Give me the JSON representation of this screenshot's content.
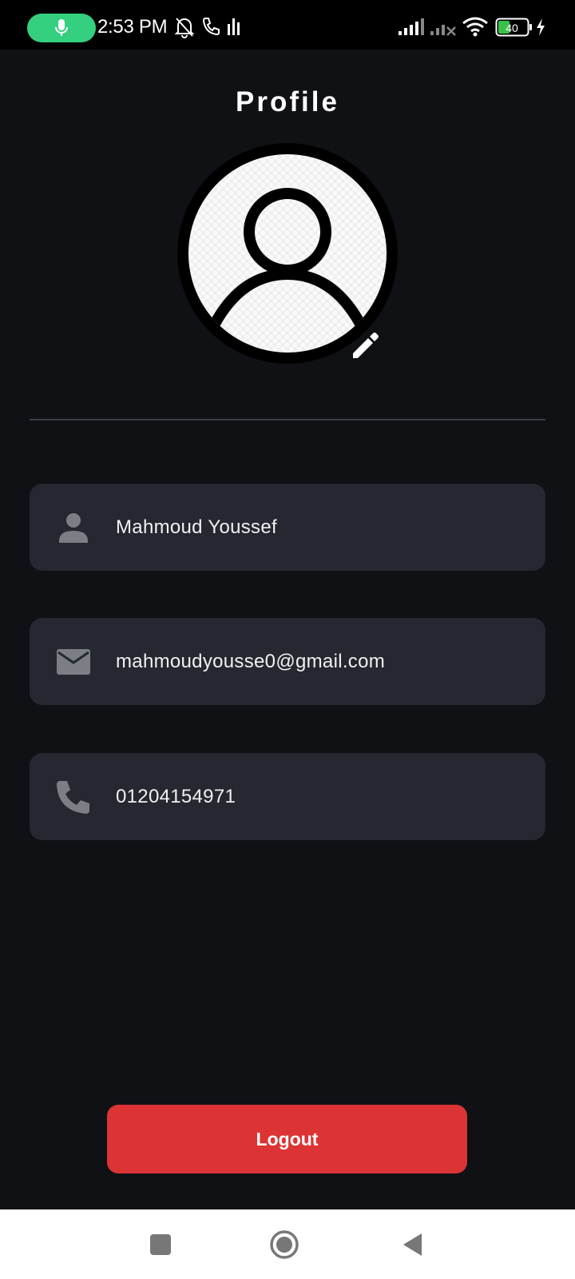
{
  "status_bar": {
    "time": "2:53 PM",
    "battery": "40",
    "icons": [
      "mic-icon",
      "bell-off-icon",
      "phone-call-icon",
      "data-activity-icon",
      "signal-icon",
      "signal-no-service-icon",
      "wifi-icon",
      "battery-icon",
      "charging-icon"
    ]
  },
  "header": {
    "title": "Profile"
  },
  "avatar": {
    "icon": "user-avatar-icon",
    "edit_icon": "pencil-icon"
  },
  "fields": {
    "name": {
      "icon": "person-icon",
      "value": "Mahmoud Youssef"
    },
    "email": {
      "icon": "mail-icon",
      "value": "mahmoudyousse0@gmail.com"
    },
    "phone": {
      "icon": "phone-icon",
      "value": "01204154971"
    }
  },
  "logout": {
    "label": "Logout"
  },
  "navigation": {
    "buttons": [
      "recents-square-icon",
      "home-circle-icon",
      "back-triangle-icon"
    ]
  },
  "colors": {
    "background": "#0f1115",
    "field_background": "#252830",
    "logout": "#dc3434",
    "mic_pill": "#35d07f",
    "battery_fill": "#39c24a"
  }
}
